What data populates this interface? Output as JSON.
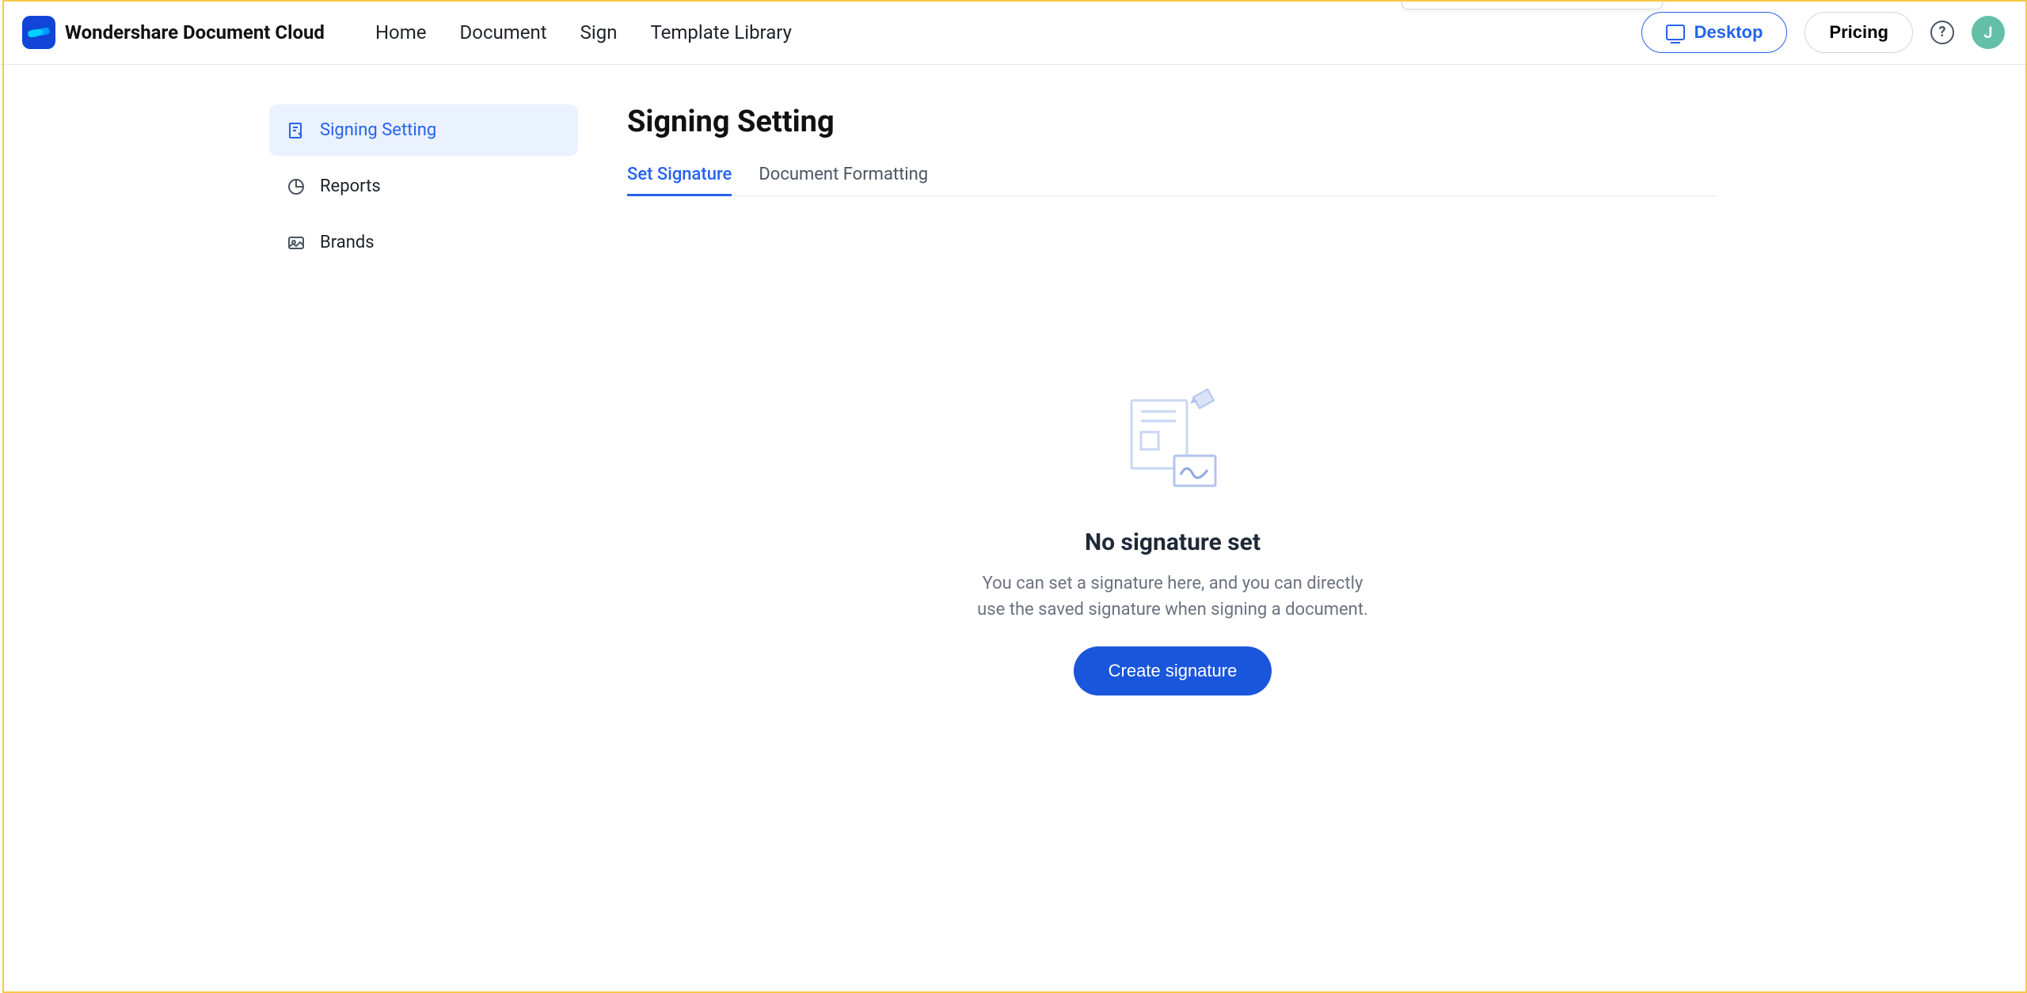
{
  "brand": "Wondershare Document Cloud",
  "nav": {
    "home": "Home",
    "document": "Document",
    "sign": "Sign",
    "template_library": "Template Library"
  },
  "header": {
    "desktop": "Desktop",
    "pricing": "Pricing",
    "help_glyph": "?",
    "avatar_initial": "J"
  },
  "sidebar": {
    "signing_setting": "Signing Setting",
    "reports": "Reports",
    "brands": "Brands"
  },
  "page": {
    "title": "Signing Setting"
  },
  "tabs": {
    "set_signature": "Set Signature",
    "document_formatting": "Document Formatting"
  },
  "empty": {
    "title": "No signature set",
    "desc": "You can set a signature here, and you can directly use the saved signature when signing a document.",
    "cta": "Create signature"
  }
}
